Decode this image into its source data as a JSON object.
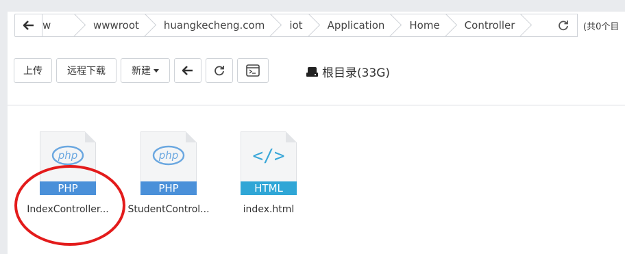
{
  "pathbar": {
    "back_icon": "arrow-left-icon",
    "crumbs": [
      "w",
      "wwwroot",
      "huangkecheng.com",
      "iot",
      "Application",
      "Home",
      "Controller"
    ],
    "refresh_icon": "refresh-icon",
    "count_text": "(共0个目"
  },
  "toolbar": {
    "upload": "上传",
    "remote_download": "远程下载",
    "new": "新建",
    "back_icon": "arrow-left-icon",
    "refresh_icon": "refresh-icon",
    "terminal_icon": "terminal-icon"
  },
  "disk": {
    "label": "根目录(33G)",
    "icon": "hdd-icon"
  },
  "files": [
    {
      "name": "IndexController...",
      "type": "PHP",
      "badge": "php",
      "band_color": "#4a90d9",
      "glyph_color": "#6aa7e0"
    },
    {
      "name": "StudentControl...",
      "type": "PHP",
      "badge": "php",
      "band_color": "#4a90d9",
      "glyph_color": "#6aa7e0"
    },
    {
      "name": "index.html",
      "type": "HTML",
      "badge": "</>",
      "band_color": "#2fa6d6",
      "glyph_color": "#3aa7d8"
    }
  ],
  "annotation": {
    "color": "#e31b1b"
  }
}
